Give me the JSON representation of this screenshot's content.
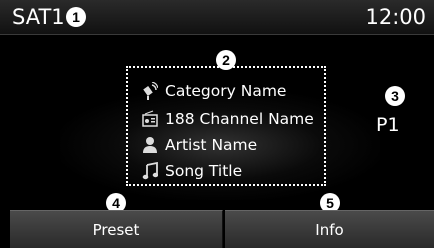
{
  "status_bar": {
    "source": "SAT1",
    "time": "12:00"
  },
  "info": {
    "category": "Category Name",
    "channel": "188 Channel Name",
    "artist": "Artist Name",
    "song": "Song Title"
  },
  "preset_indicator": "P1",
  "buttons": {
    "preset": "Preset",
    "info": "Info"
  },
  "callouts": [
    "1",
    "2",
    "3",
    "4",
    "5"
  ],
  "icons": [
    "satellite-icon",
    "radio-icon",
    "person-icon",
    "music-note-icon"
  ]
}
